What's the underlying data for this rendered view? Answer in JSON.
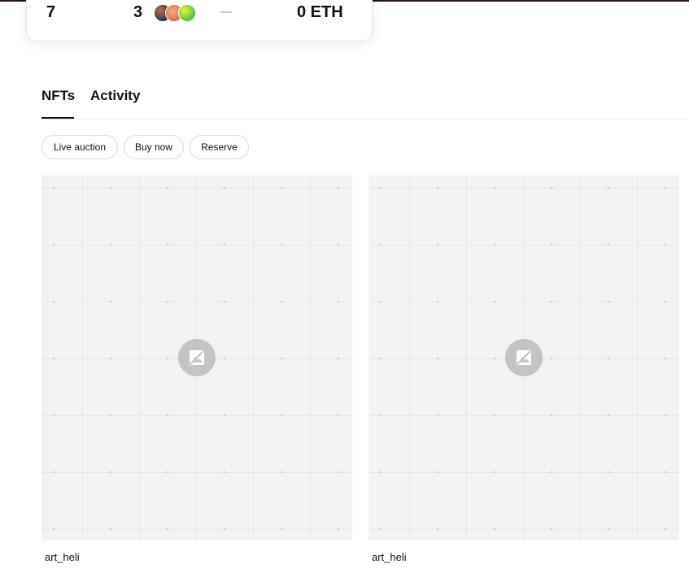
{
  "stats": {
    "first_value": "7",
    "second_value": "3",
    "placeholder_dash": "—",
    "eth_value": "0 ETH",
    "avatar_icons": [
      "avatar-gradient-teal",
      "avatar-gradient-orange",
      "avatar-gradient-green"
    ]
  },
  "tabs": [
    {
      "label": "NFTs",
      "active": true
    },
    {
      "label": "Activity",
      "active": false
    }
  ],
  "filters": [
    {
      "label": "Live auction"
    },
    {
      "label": "Buy now"
    },
    {
      "label": "Reserve"
    }
  ],
  "cards": [
    {
      "name": "art_heli",
      "image_icon": "image-unavailable-icon"
    },
    {
      "name": "art_heli",
      "image_icon": "image-unavailable-icon"
    }
  ],
  "colors": {
    "text": "#111111",
    "card_bg": "#f2f2f2",
    "placeholder_circle": "#c4c4c4",
    "border": "#dcdcdc"
  }
}
